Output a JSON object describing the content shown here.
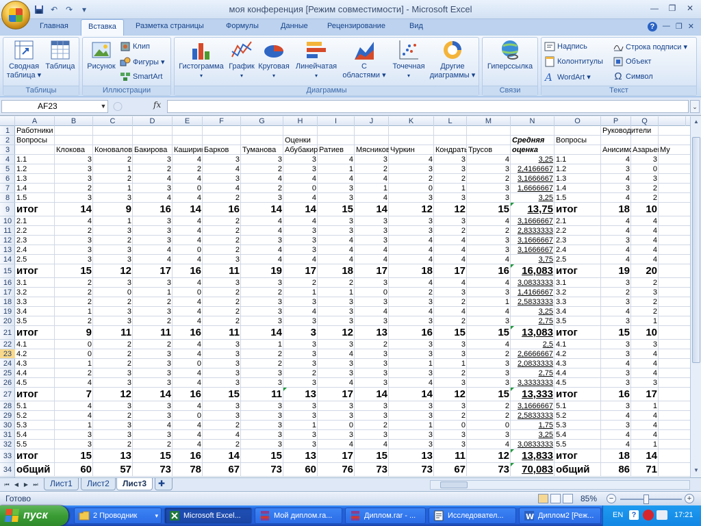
{
  "window": {
    "title": "моя конференция  [Режим совместимости] - Microsoft Excel",
    "controls": [
      "—",
      "❐",
      "✕"
    ],
    "doc_controls": [
      "—",
      "❐",
      "✕"
    ]
  },
  "qat": [
    "save-icon",
    "undo-icon",
    "redo-icon",
    "customize-icon"
  ],
  "ribbon": {
    "tabs": [
      "Главная",
      "Вставка",
      "Разметка страницы",
      "Формулы",
      "Данные",
      "Рецензирование",
      "Вид"
    ],
    "active_tab": "Вставка",
    "groups": {
      "tables": {
        "label": "Таблицы",
        "pivot": "Сводная\nтаблица ▾",
        "table": "Таблица"
      },
      "illustrations": {
        "label": "Иллюстрации",
        "picture": "Рисунок",
        "clip": "Клип",
        "shapes": "Фигуры ▾",
        "smartart": "SmartArt"
      },
      "charts": {
        "label": "Диаграммы",
        "column": "Гистограмма",
        "line": "График",
        "pie": "Круговая",
        "bar": "Линейчатая",
        "area": "С\nобластями ▾",
        "scatter": "Точечная",
        "other": "Другие\nдиаграммы ▾"
      },
      "links": {
        "label": "Связи",
        "hyperlink": "Гиперссылка"
      },
      "text": {
        "label": "Текст",
        "textbox": "Надпись",
        "header": "Колонтитулы",
        "wordart": "WordArt ▾",
        "signature": "Строка подписи ▾",
        "object": "Объект",
        "symbol": "Символ"
      }
    }
  },
  "formula_bar": {
    "name_box": "AF23",
    "fx": "fx",
    "value": ""
  },
  "columns": [
    "A",
    "B",
    "C",
    "D",
    "E",
    "F",
    "G",
    "H",
    "I",
    "J",
    "K",
    "L",
    "M",
    "N",
    "O",
    "P",
    "Q"
  ],
  "rows": [
    "1",
    "2",
    "3",
    "4",
    "5",
    "6",
    "7",
    "8",
    "9",
    "10",
    "11",
    "12",
    "13",
    "14",
    "15",
    "16",
    "17",
    "18",
    "19",
    "20",
    "21",
    "22",
    "23",
    "24",
    "25",
    "26",
    "27",
    "28",
    "29",
    "30",
    "31",
    "32",
    "33",
    "34"
  ],
  "selected_row": "23",
  "sheet": {
    "r1": {
      "a": "Работники",
      "p": "Руководители"
    },
    "r2": {
      "a": "Вопросы",
      "scores_header": "Оценки",
      "o": "Вопросы"
    },
    "r3": {
      "names": [
        "Клокова",
        "Коновалов",
        "Бакирова",
        "Каширина",
        "Барков",
        "Туманова",
        "Абубакиров",
        "Ратиев",
        "Мясников",
        "Чуркин",
        "Кондратьев",
        "Трусов"
      ],
      "avg_1": "Средняя",
      "avg_2": "оценка",
      "p": "Анисимов",
      "q": "Азарьева",
      "r": "Му"
    },
    "data": [
      {
        "a": "1.1",
        "v": [
          "3",
          "2",
          "3",
          "4",
          "3",
          "3",
          "3",
          "4",
          "3",
          "4",
          "3",
          "4"
        ],
        "n": "3,25",
        "o": "1.1",
        "p": "4",
        "q": "3"
      },
      {
        "a": "1.2",
        "v": [
          "3",
          "1",
          "2",
          "2",
          "4",
          "2",
          "3",
          "1",
          "2",
          "3",
          "3",
          "3"
        ],
        "n": "2,4166667",
        "o": "1.2",
        "p": "3",
        "q": "0"
      },
      {
        "a": "1.3",
        "v": [
          "3",
          "2",
          "4",
          "4",
          "3",
          "4",
          "4",
          "4",
          "4",
          "2",
          "2",
          "2"
        ],
        "n": "3,1666667",
        "o": "1.3",
        "p": "4",
        "q": "3"
      },
      {
        "a": "1.4",
        "v": [
          "2",
          "1",
          "3",
          "0",
          "4",
          "2",
          "0",
          "3",
          "1",
          "0",
          "1",
          "3"
        ],
        "n": "1,6666667",
        "o": "1.4",
        "p": "3",
        "q": "2"
      },
      {
        "a": "1.5",
        "v": [
          "3",
          "3",
          "4",
          "4",
          "2",
          "3",
          "4",
          "3",
          "4",
          "3",
          "3",
          "3"
        ],
        "n": "3,25",
        "o": "1.5",
        "p": "4",
        "q": "2"
      },
      {
        "a": "итог",
        "total": true,
        "v": [
          "14",
          "9",
          "16",
          "14",
          "16",
          "14",
          "14",
          "15",
          "14",
          "12",
          "12",
          "15"
        ],
        "n": "13,75",
        "o": "итог",
        "p": "18",
        "q": "10"
      },
      {
        "a": "2.1",
        "v": [
          "4",
          "1",
          "3",
          "4",
          "2",
          "4",
          "4",
          "3",
          "3",
          "3",
          "3",
          "4"
        ],
        "n": "3,1666667",
        "o": "2.1",
        "p": "4",
        "q": "4"
      },
      {
        "a": "2.2",
        "v": [
          "2",
          "3",
          "3",
          "4",
          "2",
          "4",
          "3",
          "3",
          "3",
          "3",
          "2",
          "2"
        ],
        "n": "2,8333333",
        "o": "2.2",
        "p": "4",
        "q": "4"
      },
      {
        "a": "2.3",
        "v": [
          "3",
          "2",
          "3",
          "4",
          "2",
          "3",
          "3",
          "4",
          "3",
          "4",
          "4",
          "3"
        ],
        "n": "3,1666667",
        "o": "2.3",
        "p": "3",
        "q": "4"
      },
      {
        "a": "2.4",
        "v": [
          "3",
          "3",
          "4",
          "0",
          "2",
          "4",
          "3",
          "4",
          "4",
          "4",
          "4",
          "3"
        ],
        "n": "3,1666667",
        "o": "2.4",
        "p": "4",
        "q": "4"
      },
      {
        "a": "2.5",
        "v": [
          "3",
          "3",
          "4",
          "4",
          "3",
          "4",
          "4",
          "4",
          "4",
          "4",
          "4",
          "4"
        ],
        "n": "3,75",
        "o": "2.5",
        "p": "4",
        "q": "4"
      },
      {
        "a": "итог",
        "total": true,
        "v": [
          "15",
          "12",
          "17",
          "16",
          "11",
          "19",
          "17",
          "18",
          "17",
          "18",
          "17",
          "16"
        ],
        "n": "16,083",
        "o": "итог",
        "p": "19",
        "q": "20"
      },
      {
        "a": "3.1",
        "v": [
          "2",
          "3",
          "3",
          "4",
          "3",
          "3",
          "2",
          "2",
          "3",
          "4",
          "4",
          "4"
        ],
        "n": "3,0833333",
        "o": "3.1",
        "p": "3",
        "q": "2"
      },
      {
        "a": "3.2",
        "v": [
          "2",
          "0",
          "1",
          "0",
          "2",
          "2",
          "1",
          "1",
          "0",
          "2",
          "3",
          "3"
        ],
        "n": "1,4166667",
        "o": "3.2",
        "p": "2",
        "q": "3"
      },
      {
        "a": "3.3",
        "v": [
          "2",
          "2",
          "2",
          "4",
          "2",
          "3",
          "3",
          "3",
          "3",
          "3",
          "2",
          "1"
        ],
        "n": "2,5833333",
        "o": "3.3",
        "p": "3",
        "q": "2"
      },
      {
        "a": "3.4",
        "v": [
          "1",
          "3",
          "3",
          "4",
          "2",
          "3",
          "4",
          "3",
          "4",
          "4",
          "4",
          "4"
        ],
        "n": "3,25",
        "o": "3.4",
        "p": "4",
        "q": "2"
      },
      {
        "a": "3.5",
        "v": [
          "2",
          "3",
          "2",
          "4",
          "2",
          "3",
          "3",
          "3",
          "3",
          "3",
          "2",
          "3"
        ],
        "n": "2,75",
        "o": "3.5",
        "p": "3",
        "q": "1"
      },
      {
        "a": "итог",
        "total": true,
        "v": [
          "9",
          "11",
          "11",
          "16",
          "11",
          "14",
          "3",
          "12",
          "13",
          "16",
          "15",
          "15"
        ],
        "n": "13,083",
        "o": "итог",
        "p": "15",
        "q": "10"
      },
      {
        "a": "4.1",
        "v": [
          "0",
          "2",
          "2",
          "4",
          "3",
          "1",
          "3",
          "3",
          "2",
          "3",
          "3",
          "4"
        ],
        "n": "2,5",
        "o": "4.1",
        "p": "3",
        "q": "3"
      },
      {
        "a": "4.2",
        "v": [
          "0",
          "2",
          "3",
          "4",
          "3",
          "2",
          "3",
          "4",
          "3",
          "3",
          "3",
          "2"
        ],
        "n": "2,6666667",
        "o": "4.2",
        "p": "3",
        "q": "4"
      },
      {
        "a": "4.3",
        "v": [
          "1",
          "2",
          "3",
          "0",
          "3",
          "2",
          "3",
          "3",
          "3",
          "1",
          "1",
          "3"
        ],
        "n": "2,0833333",
        "o": "4.3",
        "p": "4",
        "q": "4"
      },
      {
        "a": "4.4",
        "v": [
          "2",
          "3",
          "3",
          "4",
          "3",
          "3",
          "2",
          "3",
          "3",
          "3",
          "2",
          "3"
        ],
        "n": "2,75",
        "o": "4.4",
        "p": "3",
        "q": "4"
      },
      {
        "a": "4.5",
        "v": [
          "4",
          "3",
          "3",
          "4",
          "3",
          "3",
          "3",
          "4",
          "3",
          "4",
          "3",
          "3"
        ],
        "n": "3,3333333",
        "o": "4.5",
        "p": "3",
        "q": "3"
      },
      {
        "a": "итог",
        "total": true,
        "v": [
          "7",
          "12",
          "14",
          "16",
          "15",
          "11",
          "13",
          "17",
          "14",
          "14",
          "12",
          "15"
        ],
        "n": "13,333",
        "o": "итог",
        "p": "16",
        "q": "17"
      },
      {
        "a": "5.1",
        "v": [
          "4",
          "3",
          "3",
          "4",
          "3",
          "3",
          "3",
          "3",
          "3",
          "3",
          "3",
          "2"
        ],
        "n": "3,1666667",
        "o": "5.1",
        "p": "3",
        "q": "1"
      },
      {
        "a": "5.2",
        "v": [
          "4",
          "2",
          "3",
          "0",
          "3",
          "3",
          "3",
          "3",
          "3",
          "3",
          "2",
          "2"
        ],
        "n": "2,5833333",
        "o": "5.2",
        "p": "4",
        "q": "4"
      },
      {
        "a": "5.3",
        "v": [
          "1",
          "3",
          "4",
          "4",
          "2",
          "3",
          "1",
          "0",
          "2",
          "1",
          "0",
          "0"
        ],
        "n": "1,75",
        "o": "5.3",
        "p": "3",
        "q": "4"
      },
      {
        "a": "5.4",
        "v": [
          "3",
          "3",
          "3",
          "4",
          "4",
          "3",
          "3",
          "3",
          "3",
          "3",
          "3",
          "3"
        ],
        "n": "3,25",
        "o": "5.4",
        "p": "4",
        "q": "4"
      },
      {
        "a": "5.5",
        "v": [
          "3",
          "2",
          "2",
          "4",
          "2",
          "3",
          "3",
          "4",
          "4",
          "3",
          "3",
          "4"
        ],
        "n": "3,0833333",
        "o": "5.5",
        "p": "4",
        "q": "1"
      },
      {
        "a": "итог",
        "total": true,
        "v": [
          "15",
          "13",
          "15",
          "16",
          "14",
          "15",
          "13",
          "17",
          "15",
          "13",
          "11",
          "12"
        ],
        "n": "13,833",
        "o": "итог",
        "p": "18",
        "q": "14"
      },
      {
        "a": "общий",
        "total": true,
        "v": [
          "60",
          "57",
          "73",
          "78",
          "67",
          "73",
          "60",
          "76",
          "73",
          "73",
          "67",
          "73"
        ],
        "n": "70,083",
        "o": "общий",
        "p": "86",
        "q": "71"
      }
    ]
  },
  "sheet_tabs": [
    "Лист1",
    "Лист2",
    "Лист3"
  ],
  "active_sheet": "Лист3",
  "status": {
    "text": "Готово",
    "zoom": "85%"
  },
  "taskbar": {
    "start": "пуск",
    "buttons": [
      "2 Проводник",
      "Microsoft Excel...",
      "Мой диплом.ra...",
      "Диплом.rar - ...",
      "Исследовател...",
      "Диплом2 [Реж..."
    ],
    "active": "Microsoft Excel...",
    "lang": "EN",
    "clock": "17:21"
  },
  "colors": {
    "accent": "#15428b",
    "taskbar": "#245edb",
    "start": "#3a9c34",
    "selected_header": "#f9d98b"
  }
}
